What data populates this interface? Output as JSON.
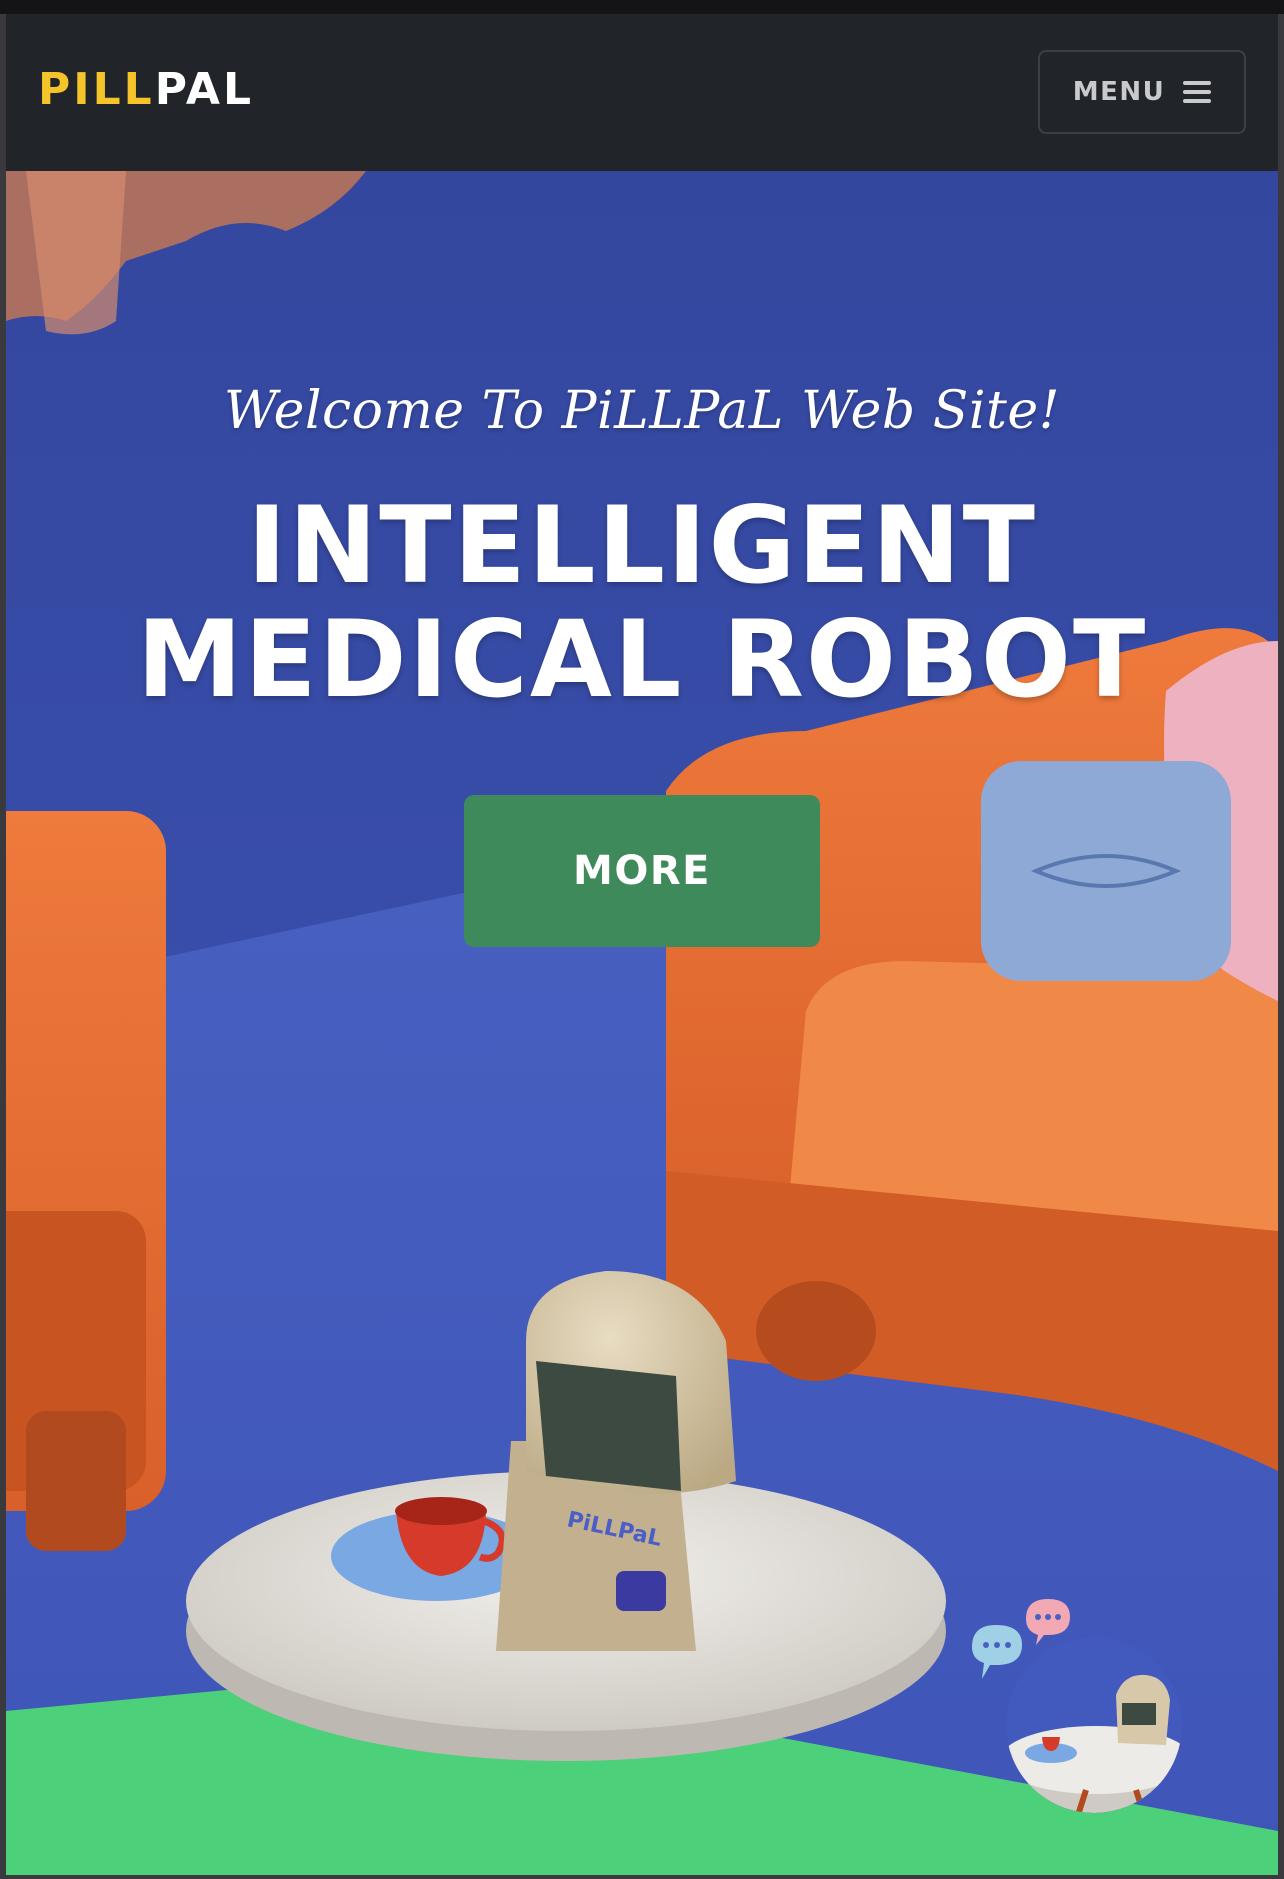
{
  "brand": {
    "part1": "PILL",
    "part2": "PAL"
  },
  "nav": {
    "menu_label": "MENU"
  },
  "hero": {
    "welcome": "Welcome To PiLLPaL Web Site!",
    "headline_line1": "INTELLIGENT",
    "headline_line2": "MEDICAL ROBOT",
    "button_label": "MORE"
  },
  "colors": {
    "accent_yellow": "#f4c42a",
    "navbar_bg": "#212428",
    "button_green": "#3f8a5a",
    "hero_blue": "#3a4fb0"
  },
  "icons": [
    "hamburger-icon",
    "chat-bubble-icon"
  ]
}
